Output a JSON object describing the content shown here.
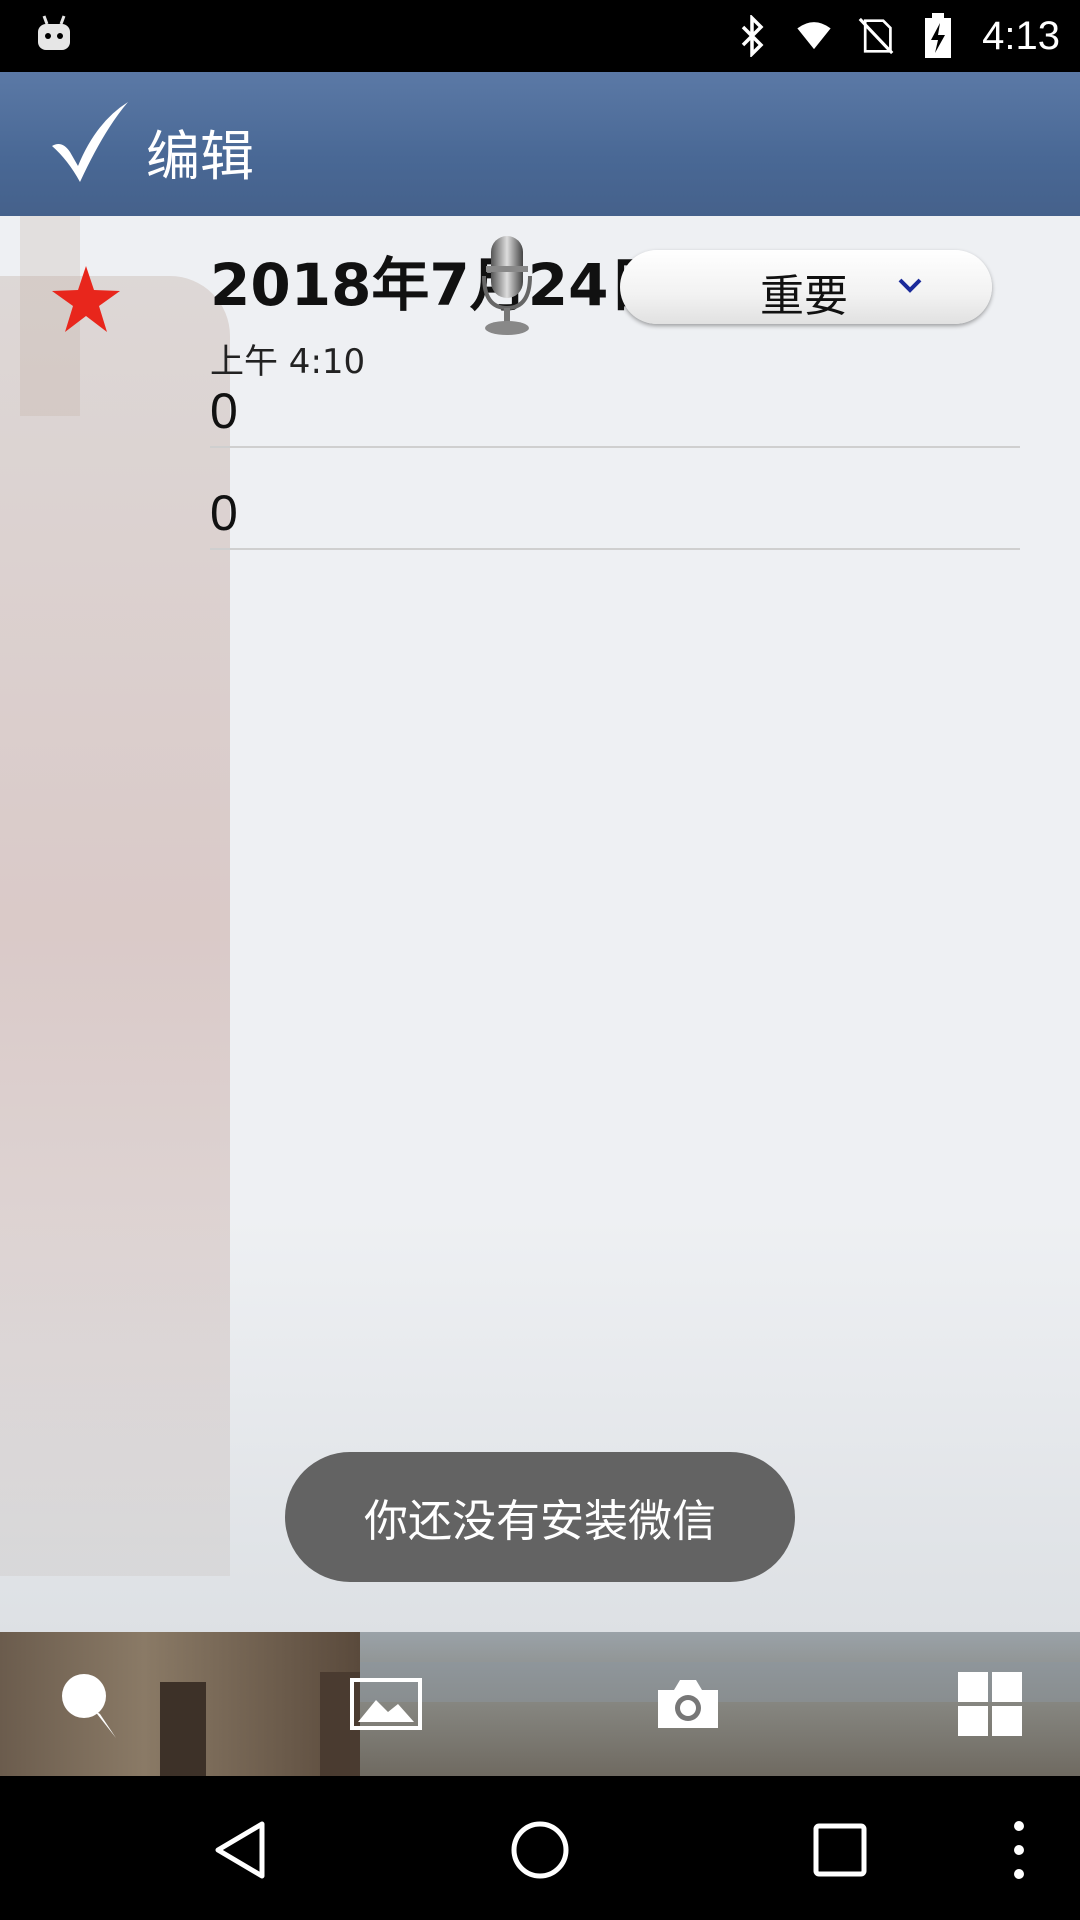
{
  "status_bar": {
    "time": "4:13",
    "icons": [
      "android-icon",
      "bluetooth-icon",
      "wifi-icon",
      "no-sim-icon",
      "battery-charging-icon"
    ]
  },
  "app_bar": {
    "title": "编辑",
    "confirm_icon": "check-icon"
  },
  "note": {
    "star_icon": "star-icon",
    "star_color": "#e8261c",
    "date": "2018年7月24日",
    "mic_icon": "microphone-icon",
    "time": "上午 4:10",
    "priority": {
      "selected": "重要",
      "icon": "chevron-down-icon"
    },
    "fields": [
      "0",
      "0"
    ]
  },
  "toast": {
    "message": "你还没有安装微信"
  },
  "toolbar": {
    "icons": [
      "pin-icon",
      "image-icon",
      "camera-icon",
      "grid-icon"
    ]
  },
  "nav_bar": {
    "icons": [
      "back-icon",
      "home-icon",
      "recents-icon",
      "more-icon"
    ]
  }
}
